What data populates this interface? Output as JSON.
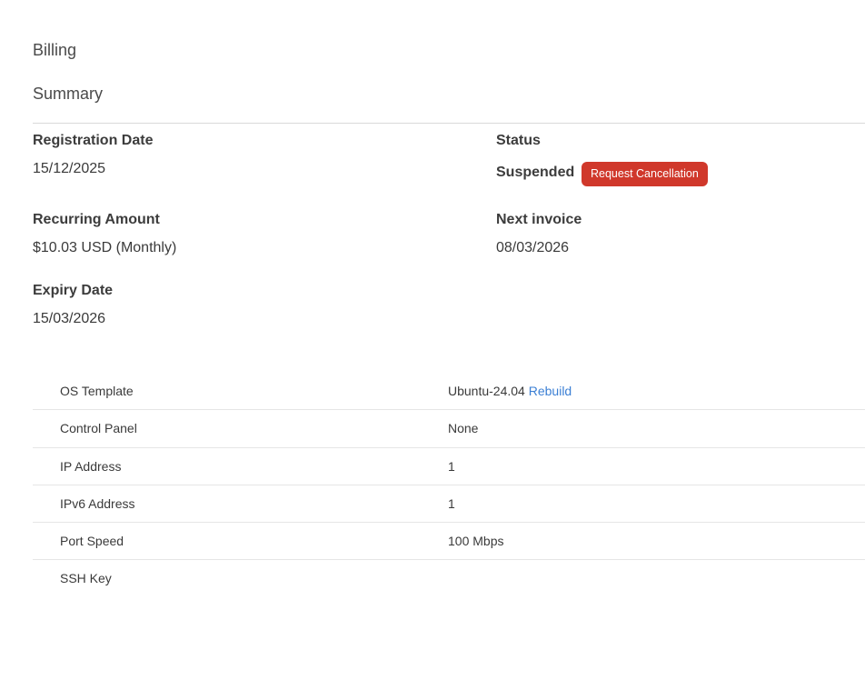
{
  "header": {
    "billing_title": "Billing",
    "summary_title": "Summary"
  },
  "summary": {
    "registration_date_label": "Registration Date",
    "registration_date_value": "15/12/2025",
    "status_label": "Status",
    "status_value": "Suspended",
    "request_cancellation_label": "Request Cancellation",
    "recurring_amount_label": "Recurring Amount",
    "recurring_amount_value": "$10.03 USD (Monthly)",
    "next_invoice_label": "Next invoice",
    "next_invoice_value": "08/03/2026",
    "expiry_date_label": "Expiry Date",
    "expiry_date_value": "15/03/2026"
  },
  "colors": {
    "cancel_button_bg": "#d0382b",
    "link": "#3b7fd4"
  },
  "specs": [
    {
      "label": "OS Template",
      "value": "Ubuntu-24.04",
      "action": "Rebuild"
    },
    {
      "label": "Control Panel",
      "value": "None"
    },
    {
      "label": "IP Address",
      "value": "1"
    },
    {
      "label": "IPv6 Address",
      "value": "1"
    },
    {
      "label": "Port Speed",
      "value": "100 Mbps"
    },
    {
      "label": "SSH Key",
      "value": ""
    }
  ]
}
